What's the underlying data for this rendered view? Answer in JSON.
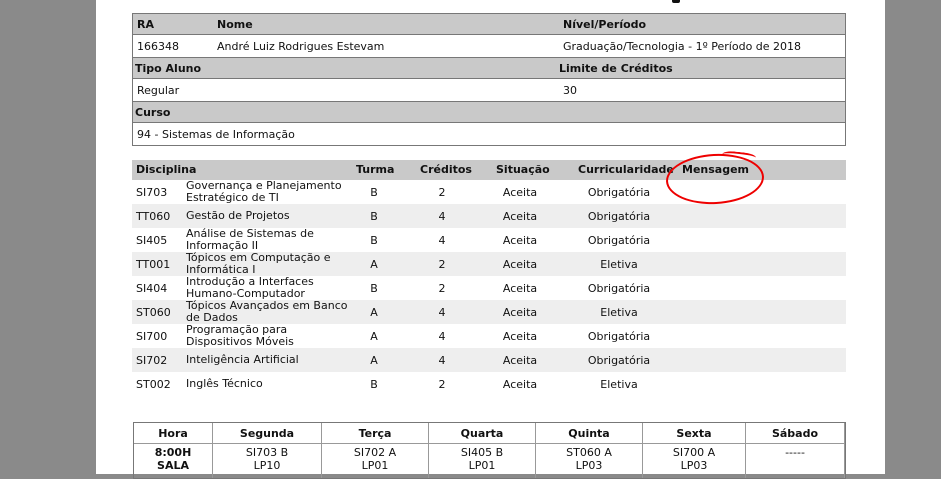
{
  "student": {
    "ra_label": "RA",
    "nome_label": "Nome",
    "nivel_label": "Nível/Período",
    "ra": "166348",
    "nome": "André Luiz Rodrigues Estevam",
    "nivel": "Graduação/Tecnologia - 1º Período de 2018",
    "tipo_label": "Tipo Aluno",
    "limite_label": "Limite de Créditos",
    "tipo": "Regular",
    "limite": "30",
    "curso_label": "Curso",
    "curso": "94 - Sistemas de Informação"
  },
  "disciplines": {
    "headers": {
      "disciplina": "Disciplina",
      "turma": "Turma",
      "creditos": "Créditos",
      "situacao": "Situação",
      "curricularidade": "Curricularidade",
      "mensagem": "Mensagem"
    },
    "rows": [
      {
        "code": "SI703",
        "name": "Governança e Planejamento Estratégico de TI",
        "turma": "B",
        "creditos": "2",
        "situacao": "Aceita",
        "curr": "Obrigatória"
      },
      {
        "code": "TT060",
        "name": "Gestão de Projetos",
        "turma": "B",
        "creditos": "4",
        "situacao": "Aceita",
        "curr": "Obrigatória"
      },
      {
        "code": "SI405",
        "name": "Análise de Sistemas de Informação II",
        "turma": "B",
        "creditos": "4",
        "situacao": "Aceita",
        "curr": "Obrigatória"
      },
      {
        "code": "TT001",
        "name": "Tópicos em Computação e Informática I",
        "turma": "A",
        "creditos": "2",
        "situacao": "Aceita",
        "curr": "Eletiva"
      },
      {
        "code": "SI404",
        "name": "Introdução a Interfaces Humano-Computador",
        "turma": "B",
        "creditos": "2",
        "situacao": "Aceita",
        "curr": "Obrigatória"
      },
      {
        "code": "ST060",
        "name": "Tópicos Avançados em Banco de Dados",
        "turma": "A",
        "creditos": "4",
        "situacao": "Aceita",
        "curr": "Eletiva"
      },
      {
        "code": "SI700",
        "name": "Programação para Dispositivos Móveis",
        "turma": "A",
        "creditos": "4",
        "situacao": "Aceita",
        "curr": "Obrigatória"
      },
      {
        "code": "SI702",
        "name": "Inteligência Artificial",
        "turma": "A",
        "creditos": "4",
        "situacao": "Aceita",
        "curr": "Obrigatória"
      },
      {
        "code": "ST002",
        "name": "Inglês Técnico",
        "turma": "B",
        "creditos": "2",
        "situacao": "Aceita",
        "curr": "Eletiva"
      }
    ]
  },
  "schedule": {
    "headers": [
      "Hora",
      "Segunda",
      "Terça",
      "Quarta",
      "Quinta",
      "Sexta",
      "Sábado"
    ],
    "row": [
      {
        "l1": "8:00H",
        "l2": "SALA"
      },
      {
        "l1": "SI703 B",
        "l2": "LP10"
      },
      {
        "l1": "SI702 A",
        "l2": "LP01"
      },
      {
        "l1": "SI405 B",
        "l2": "LP01"
      },
      {
        "l1": "ST060 A",
        "l2": "LP03"
      },
      {
        "l1": "SI700 A",
        "l2": "LP03"
      },
      {
        "l1": "",
        "l2": "-----"
      }
    ]
  },
  "colors": {
    "header_bg": "#c9c9c9",
    "alt_row": "#eeeeee",
    "annotation": "#e00000"
  }
}
